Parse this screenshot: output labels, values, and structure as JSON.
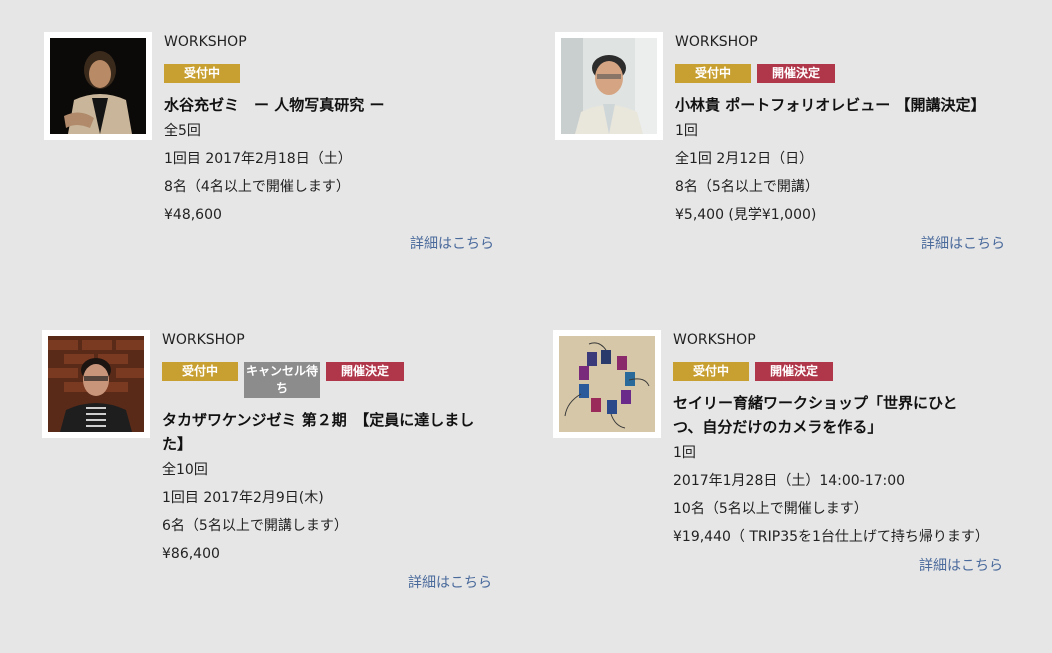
{
  "cards": [
    {
      "category": "WORKSHOP",
      "badges": [
        "受付中"
      ],
      "title": "水谷充ゼミ　ー 人物写真研究 ー",
      "sessions": "全5回",
      "date": "1回目 2017年2月18日（土）",
      "capacity": "8名（4名以上で開催します）",
      "price": "¥48,600",
      "more": "詳細はこちら"
    },
    {
      "category": "WORKSHOP",
      "badges": [
        "受付中",
        "開催決定"
      ],
      "title": "小林貴 ポートフォリオレビュー 【開講決定】",
      "sessions": "1回",
      "date": "全1回 2月12日（日）",
      "capacity": "8名（5名以上で開講）",
      "price": "¥5,400 (見学¥1,000)",
      "more": "詳細はこちら"
    },
    {
      "category": "WORKSHOP",
      "badges": [
        "受付中",
        "キャンセル待ち",
        "開催決定"
      ],
      "title": "タカザワケンジゼミ 第２期　【定員に達しました】",
      "sessions": "全10回",
      "date": "1回目 2017年2月9日(木)",
      "capacity": "6名（5名以上で開講します）",
      "price": "¥86,400",
      "more": "詳細はこちら"
    },
    {
      "category": "WORKSHOP",
      "badges": [
        "受付中",
        "開催決定"
      ],
      "title": "セイリー育緒ワークショップ「世界にひとつ、自分だけのカメラを作る」",
      "sessions": "1回",
      "date": "2017年1月28日（土）14:00-17:00",
      "capacity": "10名（5名以上で開催します）",
      "price": "¥19,440（ TRIP35を1台仕上げて持ち帰ります）",
      "more": "詳細はこちら"
    }
  ],
  "colors": {
    "open_badge": "#c8a032",
    "decided_badge": "#b0364a",
    "cancel_badge": "#8c8c8c",
    "link": "#4a6a9c",
    "background": "#e6e6e6"
  }
}
